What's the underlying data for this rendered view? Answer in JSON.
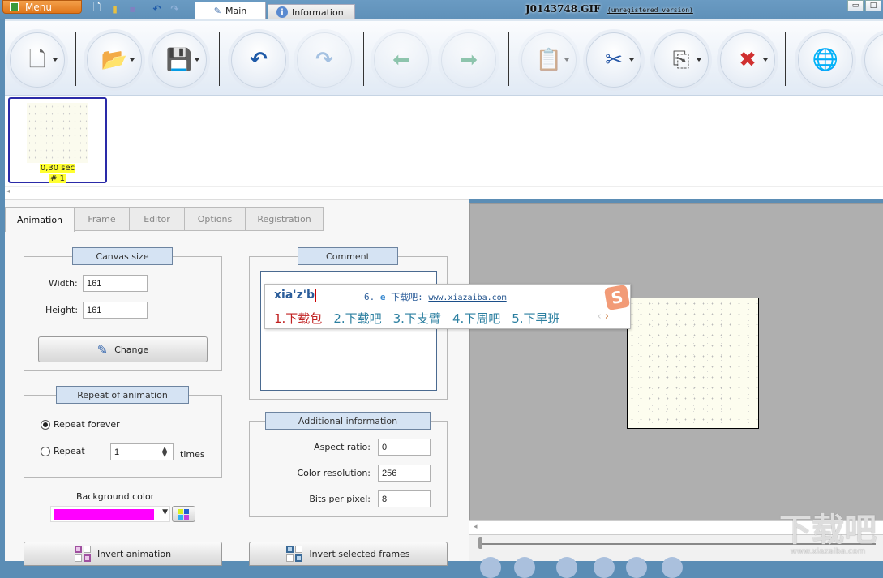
{
  "titlebar": {
    "menu_label": "Menu",
    "quick_access": [
      {
        "icon": "new-document-icon"
      },
      {
        "icon": "open-folder-icon"
      },
      {
        "icon": "save-icon"
      },
      {
        "icon": "undo-icon"
      },
      {
        "icon": "redo-icon"
      }
    ],
    "tabs": [
      {
        "label": "Main",
        "icon": "image-edit-icon",
        "active": true
      },
      {
        "label": "Information",
        "icon": "info-icon",
        "active": false
      }
    ],
    "file_name": "J0143748.GIF",
    "version_note": "(unregistered version)"
  },
  "toolbar": {
    "buttons": [
      {
        "name": "new",
        "icon": "new-document-icon",
        "dropdown": true,
        "enabled": true
      },
      {
        "name": "open",
        "icon": "open-folder-icon",
        "dropdown": true,
        "enabled": true
      },
      {
        "name": "save",
        "icon": "save-icon",
        "dropdown": true,
        "enabled": true
      },
      {
        "name": "undo",
        "icon": "undo-icon",
        "dropdown": false,
        "enabled": true
      },
      {
        "name": "redo",
        "icon": "redo-icon",
        "dropdown": false,
        "enabled": false
      },
      {
        "name": "previous",
        "icon": "arrow-left-icon",
        "dropdown": false,
        "enabled": false
      },
      {
        "name": "next",
        "icon": "arrow-right-icon",
        "dropdown": false,
        "enabled": false
      },
      {
        "name": "paste",
        "icon": "paste-icon",
        "dropdown": true,
        "enabled": false
      },
      {
        "name": "cut",
        "icon": "scissors-icon",
        "dropdown": true,
        "enabled": true
      },
      {
        "name": "copy",
        "icon": "copy-icon",
        "dropdown": true,
        "enabled": true
      },
      {
        "name": "delete",
        "icon": "delete-x-icon",
        "dropdown": true,
        "enabled": true
      },
      {
        "name": "web-search",
        "icon": "globe-search-icon",
        "dropdown": false,
        "enabled": true
      }
    ]
  },
  "filmstrip": {
    "frames": [
      {
        "duration": "0,30 sec",
        "index": "# 1",
        "selected": true
      }
    ]
  },
  "panel_tabs": [
    {
      "label": "Animation",
      "active": true
    },
    {
      "label": "Frame",
      "active": false
    },
    {
      "label": "Editor",
      "active": false
    },
    {
      "label": "Options",
      "active": false
    },
    {
      "label": "Registration",
      "active": false
    }
  ],
  "canvas_size": {
    "title": "Canvas size",
    "width_label": "Width:",
    "width_value": "161",
    "height_label": "Height:",
    "height_value": "161",
    "change_button": "Change"
  },
  "repeat": {
    "title": "Repeat of animation",
    "forever_label": "Repeat forever",
    "forever_checked": true,
    "repeat_label": "Repeat",
    "repeat_value": "1",
    "times_label": "times"
  },
  "background": {
    "label": "Background color",
    "color": "#ff00ff"
  },
  "buttons": {
    "invert_animation": "Invert animation",
    "invert_selected": "Invert selected frames"
  },
  "comment": {
    "title": "Comment",
    "value": ""
  },
  "additional_info": {
    "title": "Additional information",
    "aspect_label": "Aspect ratio:",
    "aspect_value": "0",
    "color_res_label": "Color resolution:",
    "color_res_value": "256",
    "bpp_label": "Bits per pixel:",
    "bpp_value": "8"
  },
  "ime": {
    "pinyin": "xia'z'b",
    "extra_index": "6.",
    "extra_label": "下载吧:",
    "extra_url": "www.xiazaiba.com",
    "candidates": [
      "1.下载包",
      "2.下载吧",
      "3.下支臂",
      "4.下周吧",
      "5.下早班"
    ],
    "logo": "S"
  },
  "watermark": {
    "text": "下载吧",
    "url": "www.xiazaiba.com"
  },
  "colors": {
    "accent": "#5b8db5",
    "menu_orange": "#e0761a",
    "group_title_bg": "#d5e3f3",
    "frame_border": "#2a2aa8",
    "preview_bg": "#afafaf"
  }
}
